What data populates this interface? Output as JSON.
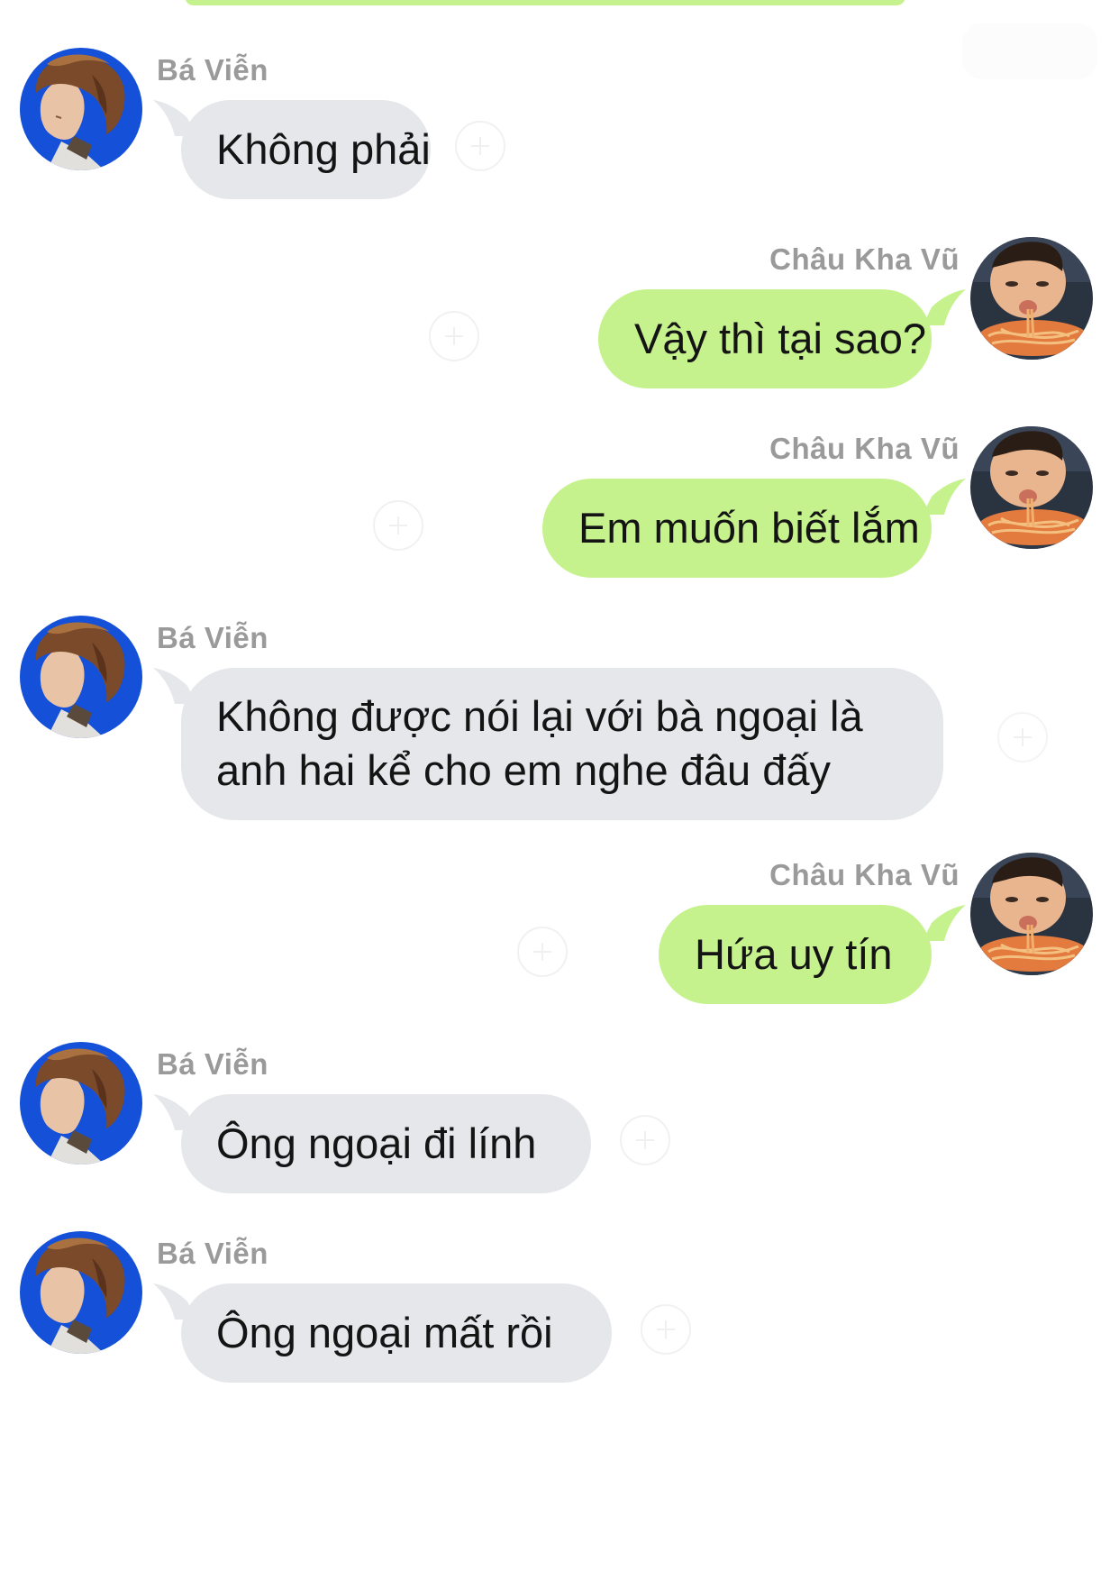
{
  "colors": {
    "incoming_bubble": "#e5e7ea",
    "outgoing_bubble": "#c6f28d",
    "sender_name": "#9a9a9a",
    "message_text": "#141414",
    "background": "#ffffff"
  },
  "icons": {
    "add_reaction": "plus-circle-icon"
  },
  "messages": [
    {
      "side": "left",
      "sender": "Bá Viễn",
      "lines": [
        "Không phải"
      ]
    },
    {
      "side": "right",
      "sender": "Châu Kha Vũ",
      "lines": [
        "Vậy thì tại sao?"
      ]
    },
    {
      "side": "right",
      "sender": "Châu Kha Vũ",
      "lines": [
        "Em muốn biết lắm"
      ]
    },
    {
      "side": "left",
      "sender": "Bá Viễn",
      "lines": [
        "Không được nói lại với bà ngoại là",
        "anh hai kể cho em nghe đâu đấy"
      ]
    },
    {
      "side": "right",
      "sender": "Châu Kha Vũ",
      "lines": [
        "Hứa uy tín"
      ]
    },
    {
      "side": "left",
      "sender": "Bá Viễn",
      "lines": [
        "Ông ngoại đi lính"
      ]
    },
    {
      "side": "left",
      "sender": "Bá Viễn",
      "lines": [
        "Ông ngoại mất rồi"
      ]
    }
  ]
}
